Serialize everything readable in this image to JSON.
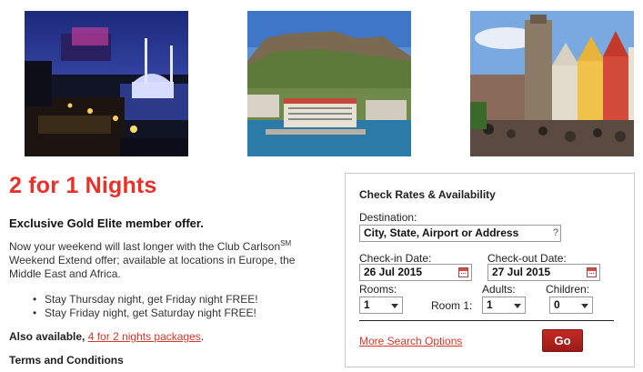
{
  "photos": [
    {
      "icon": "istanbul-night-mosque-photo"
    },
    {
      "icon": "cape-town-table-mountain-photo"
    },
    {
      "icon": "bergen-harbor-houses-photo"
    }
  ],
  "offer": {
    "headline": "2 for 1 Nights",
    "subhead": "Exclusive Gold Elite member offer.",
    "body_before": "Now your weekend will last longer with the Club Carlson",
    "body_sup": "SM",
    "body_after": " Weekend Extend offer; available at locations in Europe, the Middle East and Africa.",
    "bullets": [
      "Stay Thursday night, get Friday night FREE!",
      "Stay Friday night, get Saturday night FREE!"
    ],
    "also_label": "Also available,",
    "also_link": "4 for 2 nights packages",
    "also_end": ".",
    "terms": "Terms and Conditions"
  },
  "search": {
    "title": "Check Rates & Availability",
    "destination_label": "Destination:",
    "destination_value": "City, State, Airport or Address",
    "help_icon": "?",
    "checkin_label": "Check-in Date:",
    "checkin_value": "26 Jul 2015",
    "checkout_label": "Check-out Date:",
    "checkout_value": "27 Jul 2015",
    "rooms_label": "Rooms:",
    "rooms_value": "1",
    "room1_label": "Room 1:",
    "adults_label": "Adults:",
    "adults_value": "1",
    "children_label": "Children:",
    "children_value": "0",
    "more_options": "More Search Options",
    "go": "Go"
  },
  "colors": {
    "accent_red": "#e8312a",
    "link_red": "#d9372b",
    "button_red": "#b0231d"
  }
}
